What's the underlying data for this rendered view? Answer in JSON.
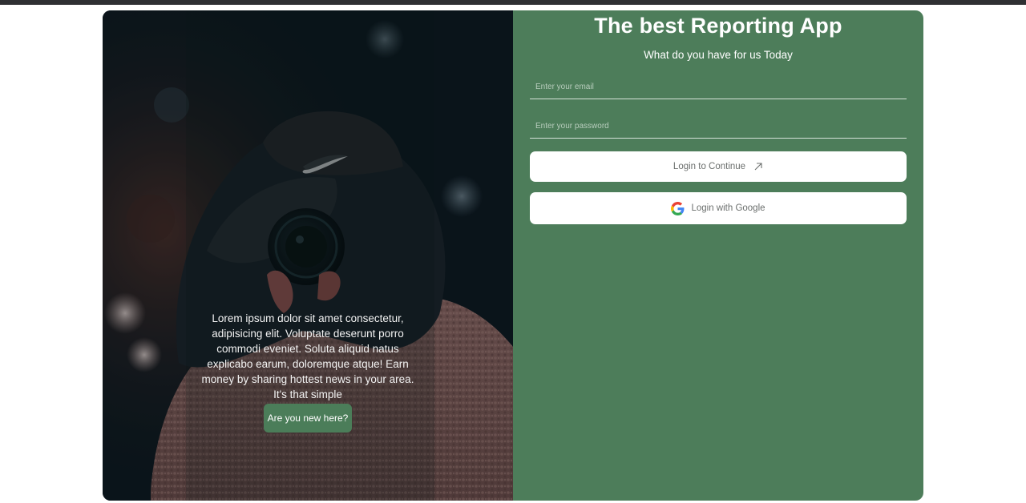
{
  "hero": {
    "description": "Lorem ipsum dolor sit amet consectetur, adipisicing elit. Voluptate deserunt porro commodi eveniet. Soluta aliquid natus explicabo earum, doloremque atque! Earn money by sharing hottest news in your area. It's that simple",
    "cta_label": "Are you new here?"
  },
  "form": {
    "title": "The best Reporting App",
    "subtitle": "What do you have for us Today",
    "email_placeholder": "Enter your email",
    "email_value": "",
    "password_placeholder": "Enter your password",
    "password_value": "",
    "login_label": "Login to Continue",
    "google_label": "Login with Google"
  },
  "icons": {
    "login": "arrow-up-right-icon",
    "google": "google-icon"
  },
  "colors": {
    "panel_green": "#4d7d5a",
    "button_green": "#4b7d59",
    "button_white": "#ffffff",
    "top_bar": "#2f3033"
  }
}
